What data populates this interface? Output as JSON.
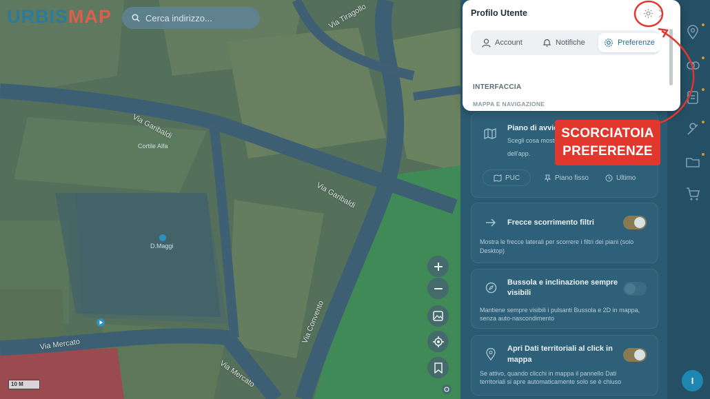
{
  "app": {
    "logo_part1": "URBIS",
    "logo_part2": "MAP"
  },
  "search": {
    "placeholder": "Cerca indirizzo..."
  },
  "map": {
    "streets": [
      "Via Tiragollo",
      "Via Garibaldi",
      "Via Garibaldi",
      "Via Mercato",
      "Via Mercato",
      "Via Convento"
    ],
    "pois": [
      "Cortile Alfa",
      "D.Maggi"
    ],
    "scale": "10 M"
  },
  "popup": {
    "title": "Profilo Utente",
    "tabs": [
      "Account",
      "Notifiche",
      "Preferenze"
    ],
    "active_tab": "Preferenze",
    "section1": "INTERFACCIA",
    "section2": "MAPPA E NAVIGAZIONE"
  },
  "panel": {
    "start_card": {
      "title": "Piano di avvio",
      "desc_line1": "Scegli cosa mostrare",
      "desc_line2": "dell'app.",
      "options": [
        "PUC",
        "Piano fisso",
        "Ultimo"
      ]
    },
    "settings": [
      {
        "title_lines": [
          "Frecce scorrimento filtri"
        ],
        "desc_lines": [
          "Mostra le frecce laterali per scorrere i filtri dei piani (solo",
          "Desktop)"
        ],
        "enabled": true
      },
      {
        "title_lines": [
          "Bussola e inclinazione sempre",
          "visibili"
        ],
        "desc_lines": [
          "Mantiene sempre visibili i pulsanti Bussola e 2D in mappa,",
          "senza auto-nascondimento"
        ],
        "enabled": false
      },
      {
        "title_lines": [
          "Apri Dati territoriali al click in",
          "mappa"
        ],
        "desc_lines": [
          "Se attivo, quando clicchi in mappa il pannello Dati",
          "territoriali si apre automaticamente solo se è chiuso"
        ],
        "enabled": true
      }
    ]
  },
  "rail": {
    "avatar_initial": "I"
  },
  "annotation": {
    "line1": "SCORCIATOIA",
    "line2": "PREFERENZE"
  },
  "colors": {
    "accent": "#1f6f92",
    "annotation_red": "#e2372d",
    "toggle_on": "#8a7a52",
    "logo_red": "#d9604a"
  }
}
